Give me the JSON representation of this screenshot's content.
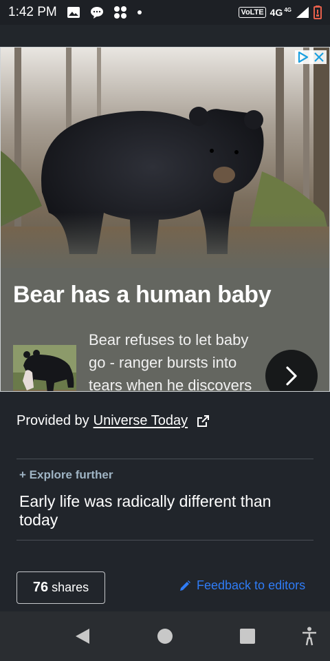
{
  "status_bar": {
    "time": "1:42 PM",
    "volte": "VoLTE",
    "network": "4G",
    "network_small": "4G",
    "icons": [
      "image-icon",
      "chat-bubble-icon",
      "apps-icon",
      "dot-icon",
      "signal-icon",
      "battery-low-icon"
    ]
  },
  "ad": {
    "headline": "Bear has a human baby",
    "body": "Bear refuses to let baby go - ranger bursts into tears when he discovers why",
    "choices_icons": [
      "adchoices-icon",
      "close-icon"
    ],
    "next_icon": "chevron-right-icon"
  },
  "article": {
    "provided_prefix": "Provided by",
    "provided_source": "Universe Today",
    "external_icon": "external-link-icon",
    "explore_label": "+ Explore further",
    "explore_title": "Early life was radically different than today",
    "shares_count": "76",
    "shares_label": "shares",
    "feedback_label": "Feedback to editors",
    "feedback_icon": "pencil-icon"
  },
  "nav_bar": {
    "icons": [
      "back-icon",
      "home-icon",
      "recents-icon",
      "accessibility-icon"
    ]
  },
  "colors": {
    "background": "#21252b",
    "link_blue": "#2f7cf6",
    "explore_label": "#9fb4c4"
  }
}
